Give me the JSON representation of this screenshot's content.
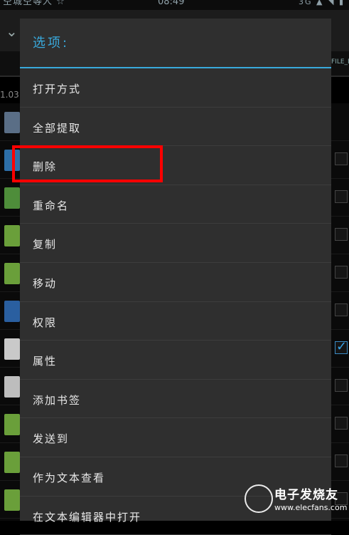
{
  "status_bar": {
    "left_text": "空城空等人 ☆",
    "time": "08:49",
    "right_text": "3G ▲ ◥ ▮"
  },
  "background": {
    "tab_label": "FILE_E",
    "path_text": "1.03",
    "checked_row": 5
  },
  "dialog": {
    "title": "选项:",
    "menu_items": [
      {
        "label": "打开方式"
      },
      {
        "label": "全部提取"
      },
      {
        "label": "删除"
      },
      {
        "label": "重命名"
      },
      {
        "label": "复制"
      },
      {
        "label": "移动"
      },
      {
        "label": "权限"
      },
      {
        "label": "属性"
      },
      {
        "label": "添加书签"
      },
      {
        "label": "发送到"
      },
      {
        "label": "作为文本查看"
      },
      {
        "label": "在文本编辑器中打开"
      }
    ]
  },
  "highlight": {
    "target": "删除",
    "color": "#ff0000"
  },
  "watermark": {
    "brand_cn": "电子发烧友",
    "url": "www.elecfans.com"
  },
  "colors": {
    "accent": "#39a9dc",
    "dialog_bg": "#2f2f2f",
    "menu_text": "#e8e8e8"
  }
}
